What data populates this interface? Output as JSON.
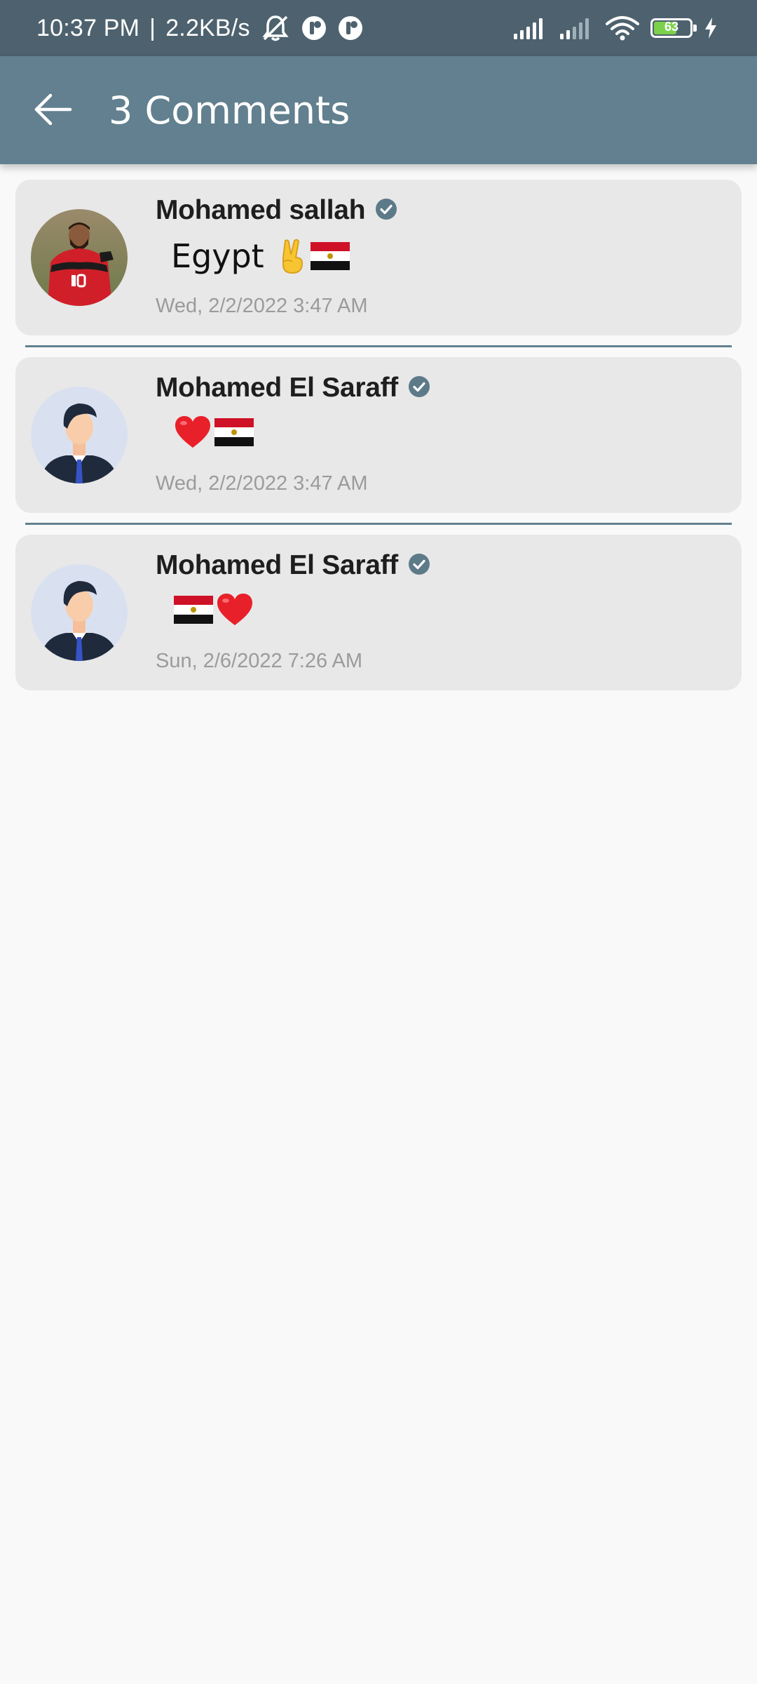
{
  "status_bar": {
    "time": "10:37 PM",
    "network_speed": "2.2KB/s",
    "battery_level": "63",
    "icons": [
      "bell-muted-icon",
      "app-notification-icon",
      "app-notification-icon",
      "signal-icon",
      "signal-icon",
      "wifi-icon",
      "battery-icon",
      "charging-icon"
    ],
    "battery_fraction": 0.63
  },
  "app_bar": {
    "title": "3 Comments",
    "back_icon": "arrow-left-icon",
    "color": "#62808f"
  },
  "comments": [
    {
      "author": "Mohamed sallah",
      "verified": true,
      "text": "Egypt",
      "emojis": [
        "victory-hand",
        "egypt-flag"
      ],
      "timestamp": "Wed, 2/2/2022 3:47 AM",
      "avatar": "player-photo"
    },
    {
      "author": "Mohamed El Saraff",
      "verified": true,
      "text": "",
      "emojis": [
        "red-heart",
        "egypt-flag"
      ],
      "timestamp": "Wed, 2/2/2022 3:47 AM",
      "avatar": "default-user-avatar"
    },
    {
      "author": "Mohamed El Saraff",
      "verified": true,
      "text": "",
      "emojis": [
        "egypt-flag",
        "red-heart"
      ],
      "timestamp": "Sun, 2/6/2022 7:26 AM",
      "avatar": "default-user-avatar"
    }
  ],
  "colors": {
    "status_bar": "#4d626e",
    "card_background": "#e8e8e8",
    "verified_badge": "#5d7a89",
    "page_background": "#f9f9f9"
  }
}
